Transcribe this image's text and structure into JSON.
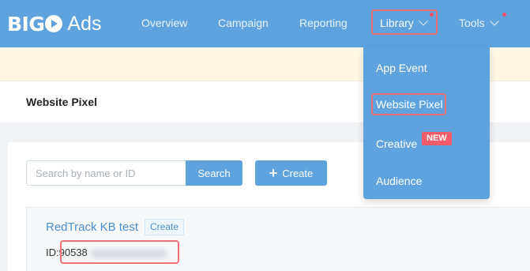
{
  "brand": {
    "name_main": "BIGO",
    "name_suffix": "Ads"
  },
  "nav": {
    "overview": "Overview",
    "campaign": "Campaign",
    "reporting": "Reporting",
    "library": "Library",
    "tools": "Tools"
  },
  "library_menu": {
    "items": [
      "App Event",
      "Website Pixel",
      "Creative",
      "Audience"
    ],
    "new_badge": "NEW"
  },
  "page": {
    "title": "Website Pixel"
  },
  "search": {
    "placeholder": "Search by name or ID",
    "value": "",
    "button": "Search"
  },
  "create_button": "Create",
  "pixel": {
    "name": "RedTrack KB test",
    "tag": "Create",
    "id_label": "ID:",
    "id_visible": "90538"
  },
  "colors": {
    "nav_bg": "#5ea3de",
    "highlight": "#f07077",
    "badge": "#f35c6a",
    "notice_bg": "#fdf7e3"
  }
}
